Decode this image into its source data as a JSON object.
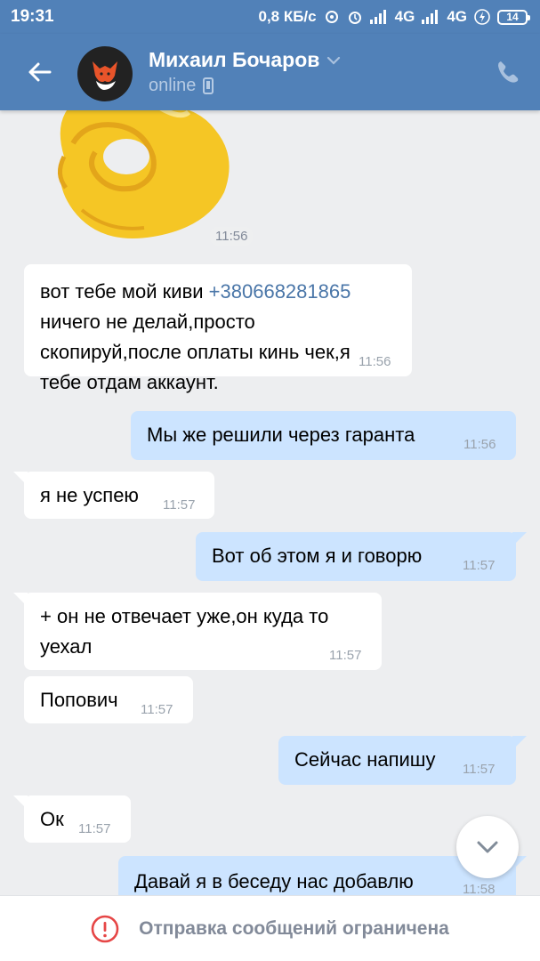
{
  "status_bar": {
    "time": "19:31",
    "speed": "0,8 КБ/с",
    "net1": "4G",
    "net2": "4G",
    "battery": "14"
  },
  "header": {
    "name": "Михаил Бочаров",
    "status": "online",
    "accent_color": "#5181b8"
  },
  "messages": [
    {
      "direction": "in",
      "sticker": "ok-hand-sticker",
      "time": "11:56"
    },
    {
      "direction": "in",
      "text_before": "вот тебе мой киви ",
      "link": "+380668281865",
      "lines_after": [
        "ничего не делай,просто",
        "скопируй,после оплаты кинь чек,я",
        "тебе отдам аккаунт."
      ],
      "time": "11:56"
    },
    {
      "direction": "out",
      "text": "Мы же решили через гаранта",
      "time": "11:56"
    },
    {
      "direction": "in",
      "text": "я не успею",
      "time": "11:57"
    },
    {
      "direction": "out",
      "text": "Вот об этом я и говорю",
      "time": "11:57"
    },
    {
      "direction": "in",
      "lines": [
        "+ он не отвечает уже,он куда то",
        "уехал"
      ],
      "time": "11:57"
    },
    {
      "direction": "in",
      "text": "Попович",
      "time": "11:57"
    },
    {
      "direction": "out",
      "text": "Сейчас напишу",
      "time": "11:57"
    },
    {
      "direction": "in",
      "text": "Ок",
      "time": "11:57"
    },
    {
      "direction": "out",
      "text": "Давай я в беседу нас добавлю",
      "time": "11:58"
    }
  ],
  "bottom_notice": "Отправка сообщений ограничена",
  "colors": {
    "incoming_bubble": "#ffffff",
    "outgoing_bubble": "#cce4ff",
    "link": "#4a76a8",
    "warning": "#e64646",
    "background": "#edeef0"
  }
}
